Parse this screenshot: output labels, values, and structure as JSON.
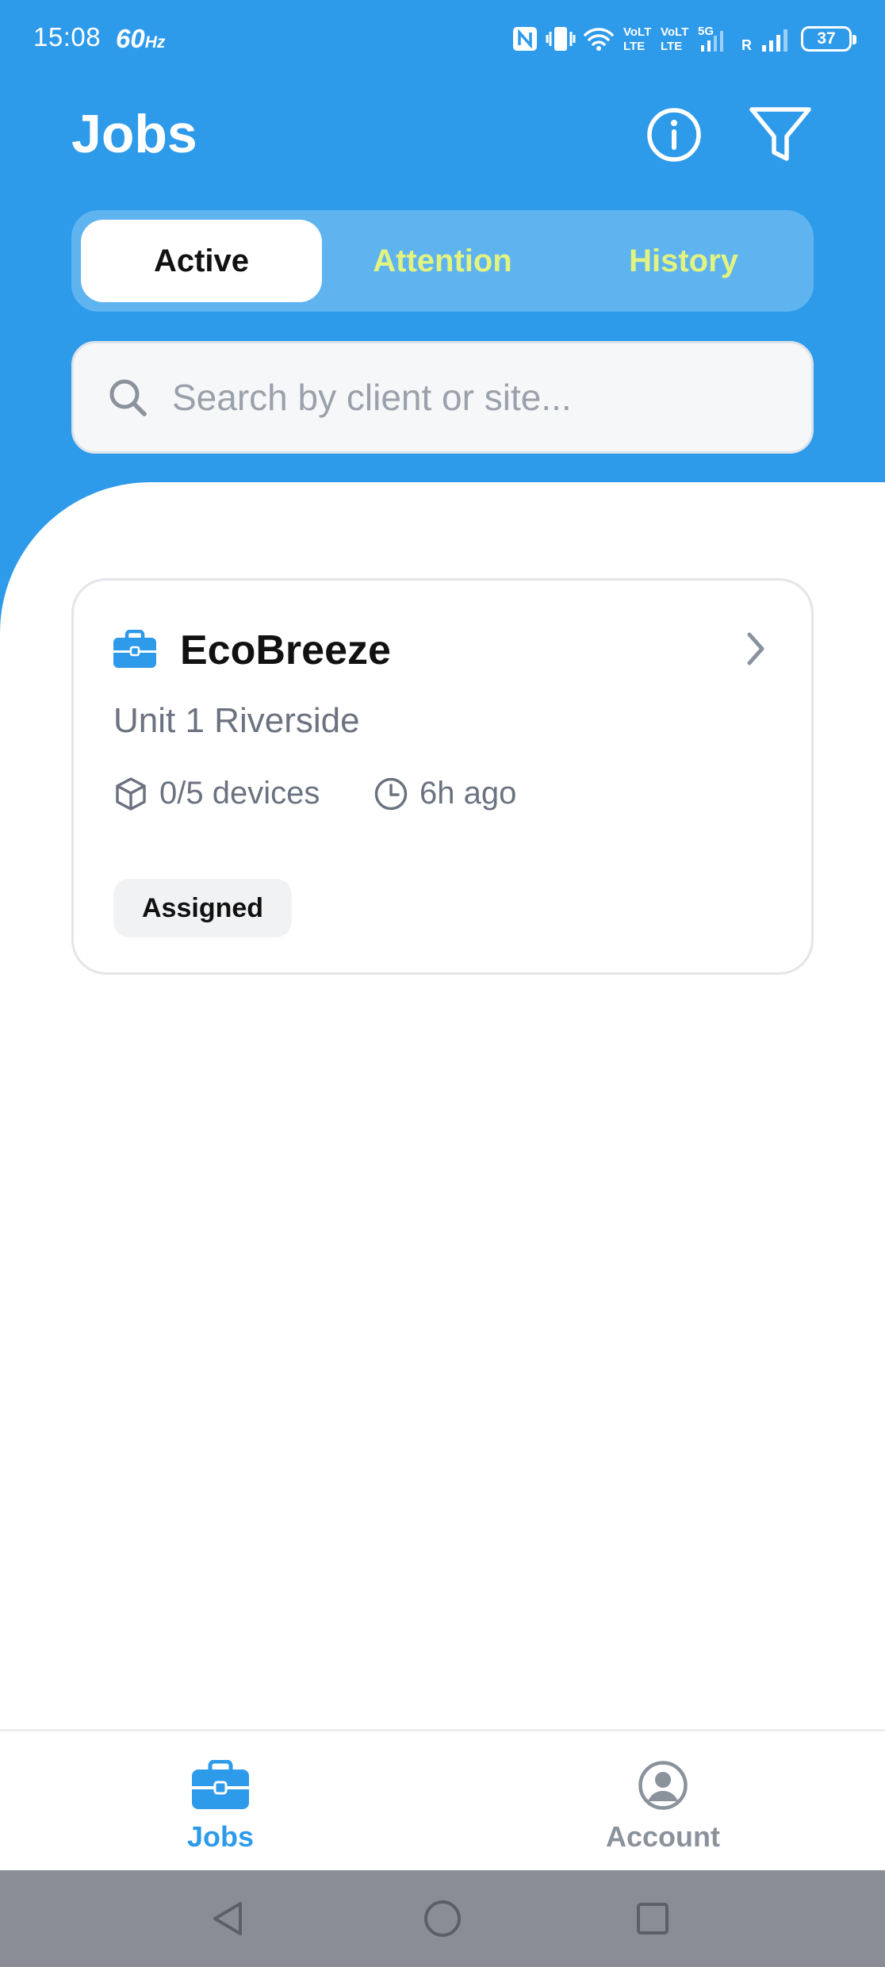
{
  "status_bar": {
    "time": "15:08",
    "refresh_rate": "60",
    "refresh_unit": "Hz",
    "battery": "37",
    "icons": [
      "nfc-icon",
      "vibrate-icon",
      "wifi-icon",
      "volte-icon",
      "volte-icon",
      "signal-5g-icon",
      "roaming-indicator",
      "signal-icon"
    ],
    "roaming_label": "R"
  },
  "header": {
    "title": "Jobs",
    "info_icon": "info-icon",
    "filter_icon": "filter-icon"
  },
  "tabs": [
    {
      "label": "Active",
      "active": true
    },
    {
      "label": "Attention",
      "active": false
    },
    {
      "label": "History",
      "active": false
    }
  ],
  "search": {
    "placeholder": "Search by client or site...",
    "value": ""
  },
  "jobs": [
    {
      "client": "EcoBreeze",
      "site": "Unit 1 Riverside",
      "devices": "0/5 devices",
      "time_ago": "6h ago",
      "status": "Assigned"
    }
  ],
  "bottom_nav": [
    {
      "label": "Jobs",
      "icon": "briefcase-icon",
      "active": true
    },
    {
      "label": "Account",
      "icon": "account-icon",
      "active": false
    }
  ],
  "system_nav": [
    "back-icon",
    "home-icon",
    "recents-icon"
  ],
  "colors": {
    "primary": "#2e9aea",
    "tab_inactive_text": "#e2f37f",
    "muted_text": "#6b7280"
  }
}
